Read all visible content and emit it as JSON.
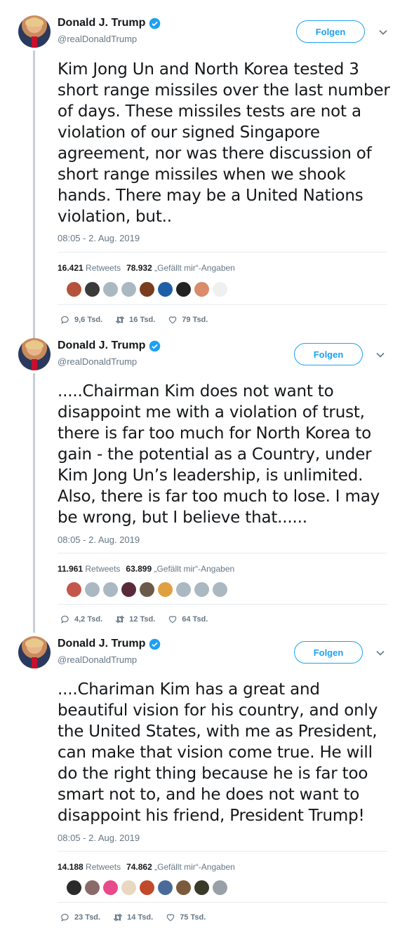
{
  "author": {
    "name": "Donald J. Trump",
    "handle": "@realDonaldTrump",
    "follow_label": "Folgen"
  },
  "labels": {
    "retweets": "Retweets",
    "likes": "„Gefällt mir“-Angaben"
  },
  "colors": {
    "accent": "#1da1f2",
    "secondary_text": "#657786",
    "thread_line": "#c4cfd6"
  },
  "tweets": [
    {
      "lines": [
        "Kim Jong Un and North Korea tested 3",
        "short range missiles over the last number",
        "of days. These missiles tests are not a",
        "violation of our signed Singapore",
        "agreement, nor was there discussion of",
        "short range missiles when we shook",
        "hands. There may be a United Nations",
        "violation, but.."
      ],
      "time": "08:05 - 2. Aug. 2019",
      "retweets": "16.421",
      "likes": "78.932",
      "replies_count": "9,6 Tsd.",
      "retweets_count": "16 Tsd.",
      "likes_count": "79 Tsd.",
      "liker_colors": [
        "#b5523b",
        "#3a3a3a",
        "#aab8c2",
        "#aab8c2",
        "#7a3b1e",
        "#1f5fa8",
        "#222222",
        "#d98b6a",
        "#f0f0f0"
      ]
    },
    {
      "lines": [
        ".....Chairman Kim does not want to",
        "disappoint me with a violation of trust,",
        "there is far too much for North Korea to",
        "gain - the potential as a Country, under",
        "Kim Jong Un’s leadership, is unlimited.",
        "Also, there is far too much to lose. I may",
        "be wrong, but I believe that......"
      ],
      "time": "08:05 - 2. Aug. 2019",
      "retweets": "11.961",
      "likes": "63.899",
      "replies_count": "4,2 Tsd.",
      "retweets_count": "12 Tsd.",
      "likes_count": "64 Tsd.",
      "liker_colors": [
        "#c4574a",
        "#aab8c2",
        "#aab8c2",
        "#5a2a3a",
        "#6b5a4a",
        "#e0a040",
        "#aab8c2",
        "#aab8c2",
        "#aab8c2"
      ]
    },
    {
      "lines": [
        "....Chariman Kim has a great and",
        "beautiful vision for his country, and only",
        "the United States, with me as President,",
        "can make that vision come true. He will",
        "do the right thing because he is far too",
        "smart not to, and he does not want to",
        "disappoint his friend, President Trump!"
      ],
      "time": "08:05 - 2. Aug. 2019",
      "retweets": "14.188",
      "likes": "74.862",
      "replies_count": "23 Tsd.",
      "retweets_count": "14 Tsd.",
      "likes_count": "75 Tsd.",
      "liker_colors": [
        "#2a2a2a",
        "#8a6a6a",
        "#e84a8a",
        "#e8d8c0",
        "#c04a2a",
        "#4a6a9a",
        "#7a5a3a",
        "#3a3a2a",
        "#9aa0a8"
      ]
    }
  ]
}
